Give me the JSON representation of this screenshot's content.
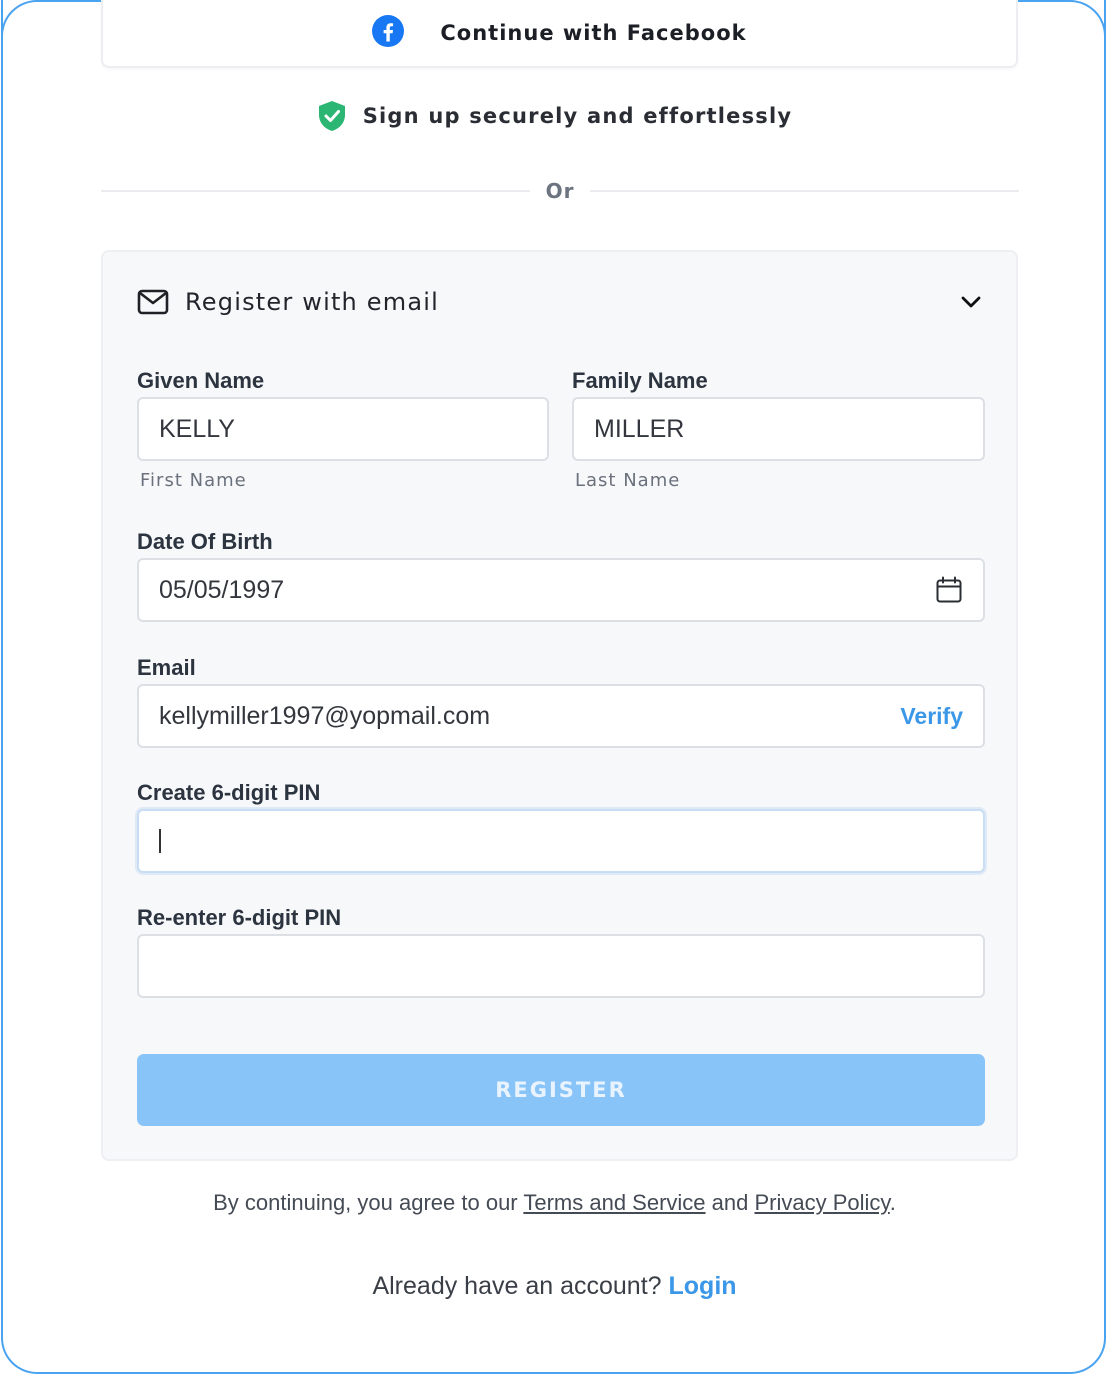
{
  "social": {
    "facebook_label": "Continue with Facebook",
    "secure_text": "Sign up securely and effortlessly"
  },
  "divider": {
    "label": "Or"
  },
  "email_section": {
    "title": "Register with email",
    "given_name": {
      "label": "Given Name",
      "value": "KELLY",
      "hint": "First Name"
    },
    "family_name": {
      "label": "Family Name",
      "value": "MILLER",
      "hint": "Last Name"
    },
    "dob": {
      "label": "Date Of Birth",
      "value": "05/05/1997"
    },
    "email": {
      "label": "Email",
      "value": "kellymiller1997@yopmail.com",
      "action": "Verify"
    },
    "pin": {
      "label": "Create 6-digit PIN",
      "value": ""
    },
    "pin_confirm": {
      "label": "Re-enter 6-digit PIN",
      "value": ""
    },
    "register_label": "REGISTER"
  },
  "footer": {
    "terms_prefix": "By continuing, you agree to our ",
    "terms_link": "Terms and Service",
    "terms_mid": " and ",
    "privacy_link": "Privacy Policy",
    "terms_suffix": ".",
    "login_prompt": "Already have an account? ",
    "login_link": "Login"
  },
  "colors": {
    "accent": "#3b97e8",
    "register_button": "#89c4f8",
    "facebook": "#1877f2",
    "shield": "#2bb673"
  }
}
